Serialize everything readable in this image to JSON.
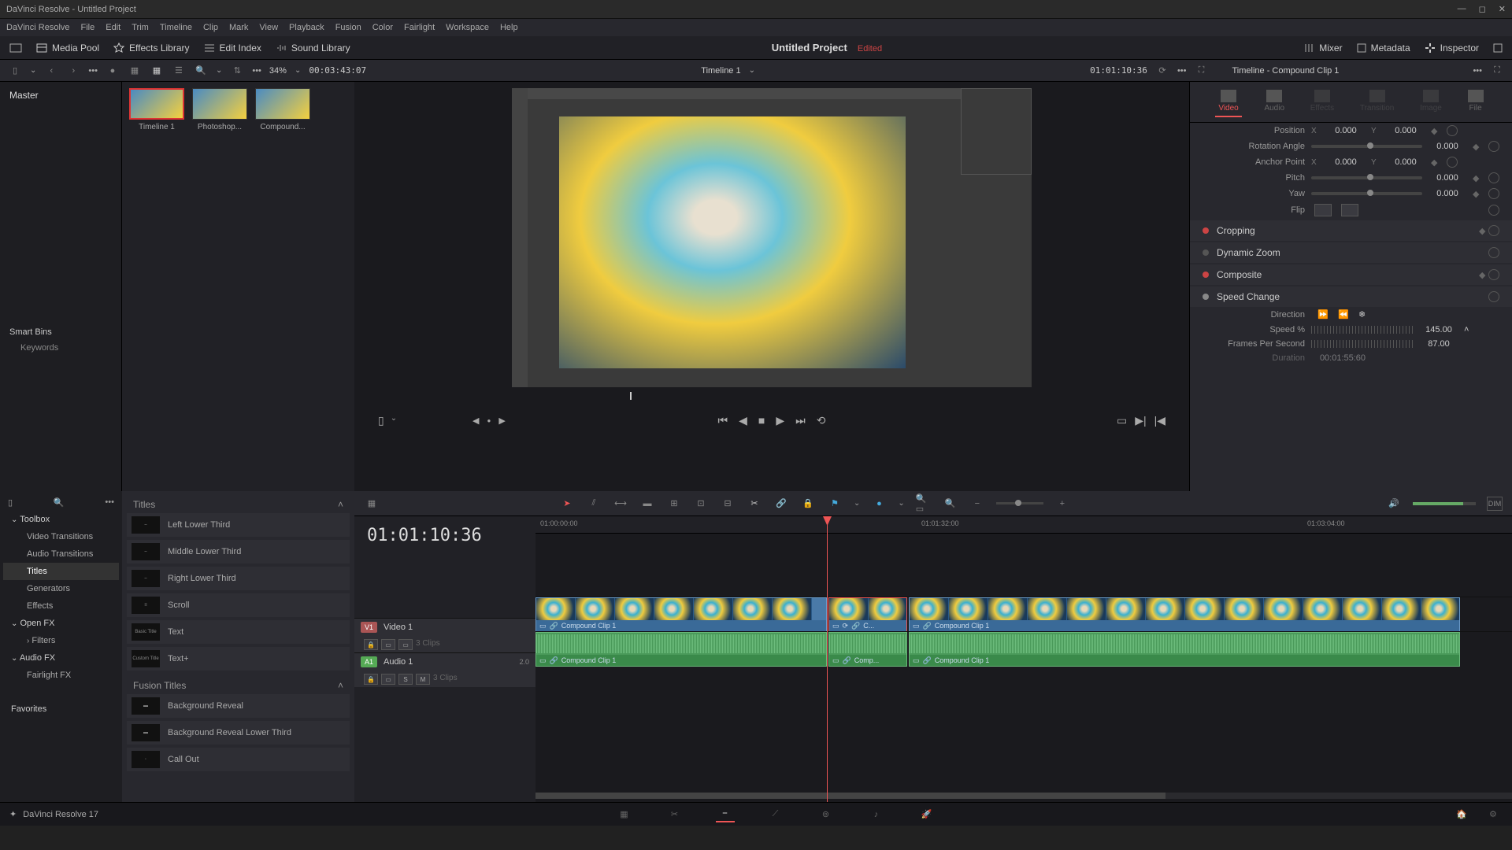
{
  "window": {
    "title": "DaVinci Resolve - Untitled Project"
  },
  "menu": [
    "DaVinci Resolve",
    "File",
    "Edit",
    "Trim",
    "Timeline",
    "Clip",
    "Mark",
    "View",
    "Playback",
    "Fusion",
    "Color",
    "Fairlight",
    "Workspace",
    "Help"
  ],
  "toolbar": {
    "media_pool": "Media Pool",
    "effects_library": "Effects Library",
    "edit_index": "Edit Index",
    "sound_library": "Sound Library",
    "project": "Untitled Project",
    "edited": "Edited",
    "mixer": "Mixer",
    "metadata": "Metadata",
    "inspector": "Inspector"
  },
  "sub": {
    "zoom": "34%",
    "src_tc": "00:03:43:07",
    "timeline_name": "Timeline 1",
    "rec_tc": "01:01:10:36"
  },
  "pool": {
    "master": "Master",
    "smart_bins": "Smart Bins",
    "keywords": "Keywords",
    "clips": [
      "Timeline 1",
      "Photoshop...",
      "Compound..."
    ]
  },
  "fx": {
    "titles": "Titles",
    "fusion_titles": "Fusion Titles",
    "tree": {
      "toolbox": "Toolbox",
      "video_transitions": "Video Transitions",
      "audio_transitions": "Audio Transitions",
      "titles_cat": "Titles",
      "generators": "Generators",
      "effects": "Effects",
      "open_fx": "Open FX",
      "filters": "Filters",
      "audio_fx": "Audio FX",
      "fairlight_fx": "Fairlight FX",
      "favorites": "Favorites"
    },
    "title_items": [
      "Left Lower Third",
      "Middle Lower Third",
      "Right Lower Third",
      "Scroll",
      "Text",
      "Text+"
    ],
    "fusion_items": [
      "Background Reveal",
      "Background Reveal Lower Third",
      "Call Out"
    ]
  },
  "inspector": {
    "header": "Timeline - Compound Clip 1",
    "tabs": {
      "video": "Video",
      "audio": "Audio",
      "effects": "Effects",
      "transition": "Transition",
      "image": "Image",
      "file": "File"
    },
    "position": "Position",
    "pos_x": "0.000",
    "pos_y": "0.000",
    "rotation": "Rotation Angle",
    "rot_val": "0.000",
    "anchor": "Anchor Point",
    "anchor_x": "0.000",
    "anchor_y": "0.000",
    "pitch": "Pitch",
    "pitch_val": "0.000",
    "yaw": "Yaw",
    "yaw_val": "0.000",
    "flip": "Flip",
    "cropping": "Cropping",
    "dynamic_zoom": "Dynamic Zoom",
    "composite": "Composite",
    "speed_change": "Speed Change",
    "direction": "Direction",
    "speed_pct": "Speed %",
    "speed_val": "145.00",
    "fps": "Frames Per Second",
    "fps_val": "87.00",
    "duration": "Duration",
    "duration_val": "00:01:55:60"
  },
  "timeline": {
    "tc_display": "01:01:10:36",
    "ruler": [
      "01:00:00:00",
      "01:01:32:00",
      "01:03:04:00"
    ],
    "video_track": {
      "badge": "V1",
      "name": "Video 1",
      "clips_count": "3 Clips"
    },
    "audio_track": {
      "badge": "A1",
      "name": "Audio 1",
      "level": "2.0",
      "clips_count": "3 Clips"
    },
    "clip_names": {
      "c1": "Compound Clip 1",
      "c2": "C...",
      "c3": "Compound Clip 1",
      "c2a": "Comp..."
    }
  },
  "bottom": {
    "app": "DaVinci Resolve 17"
  }
}
